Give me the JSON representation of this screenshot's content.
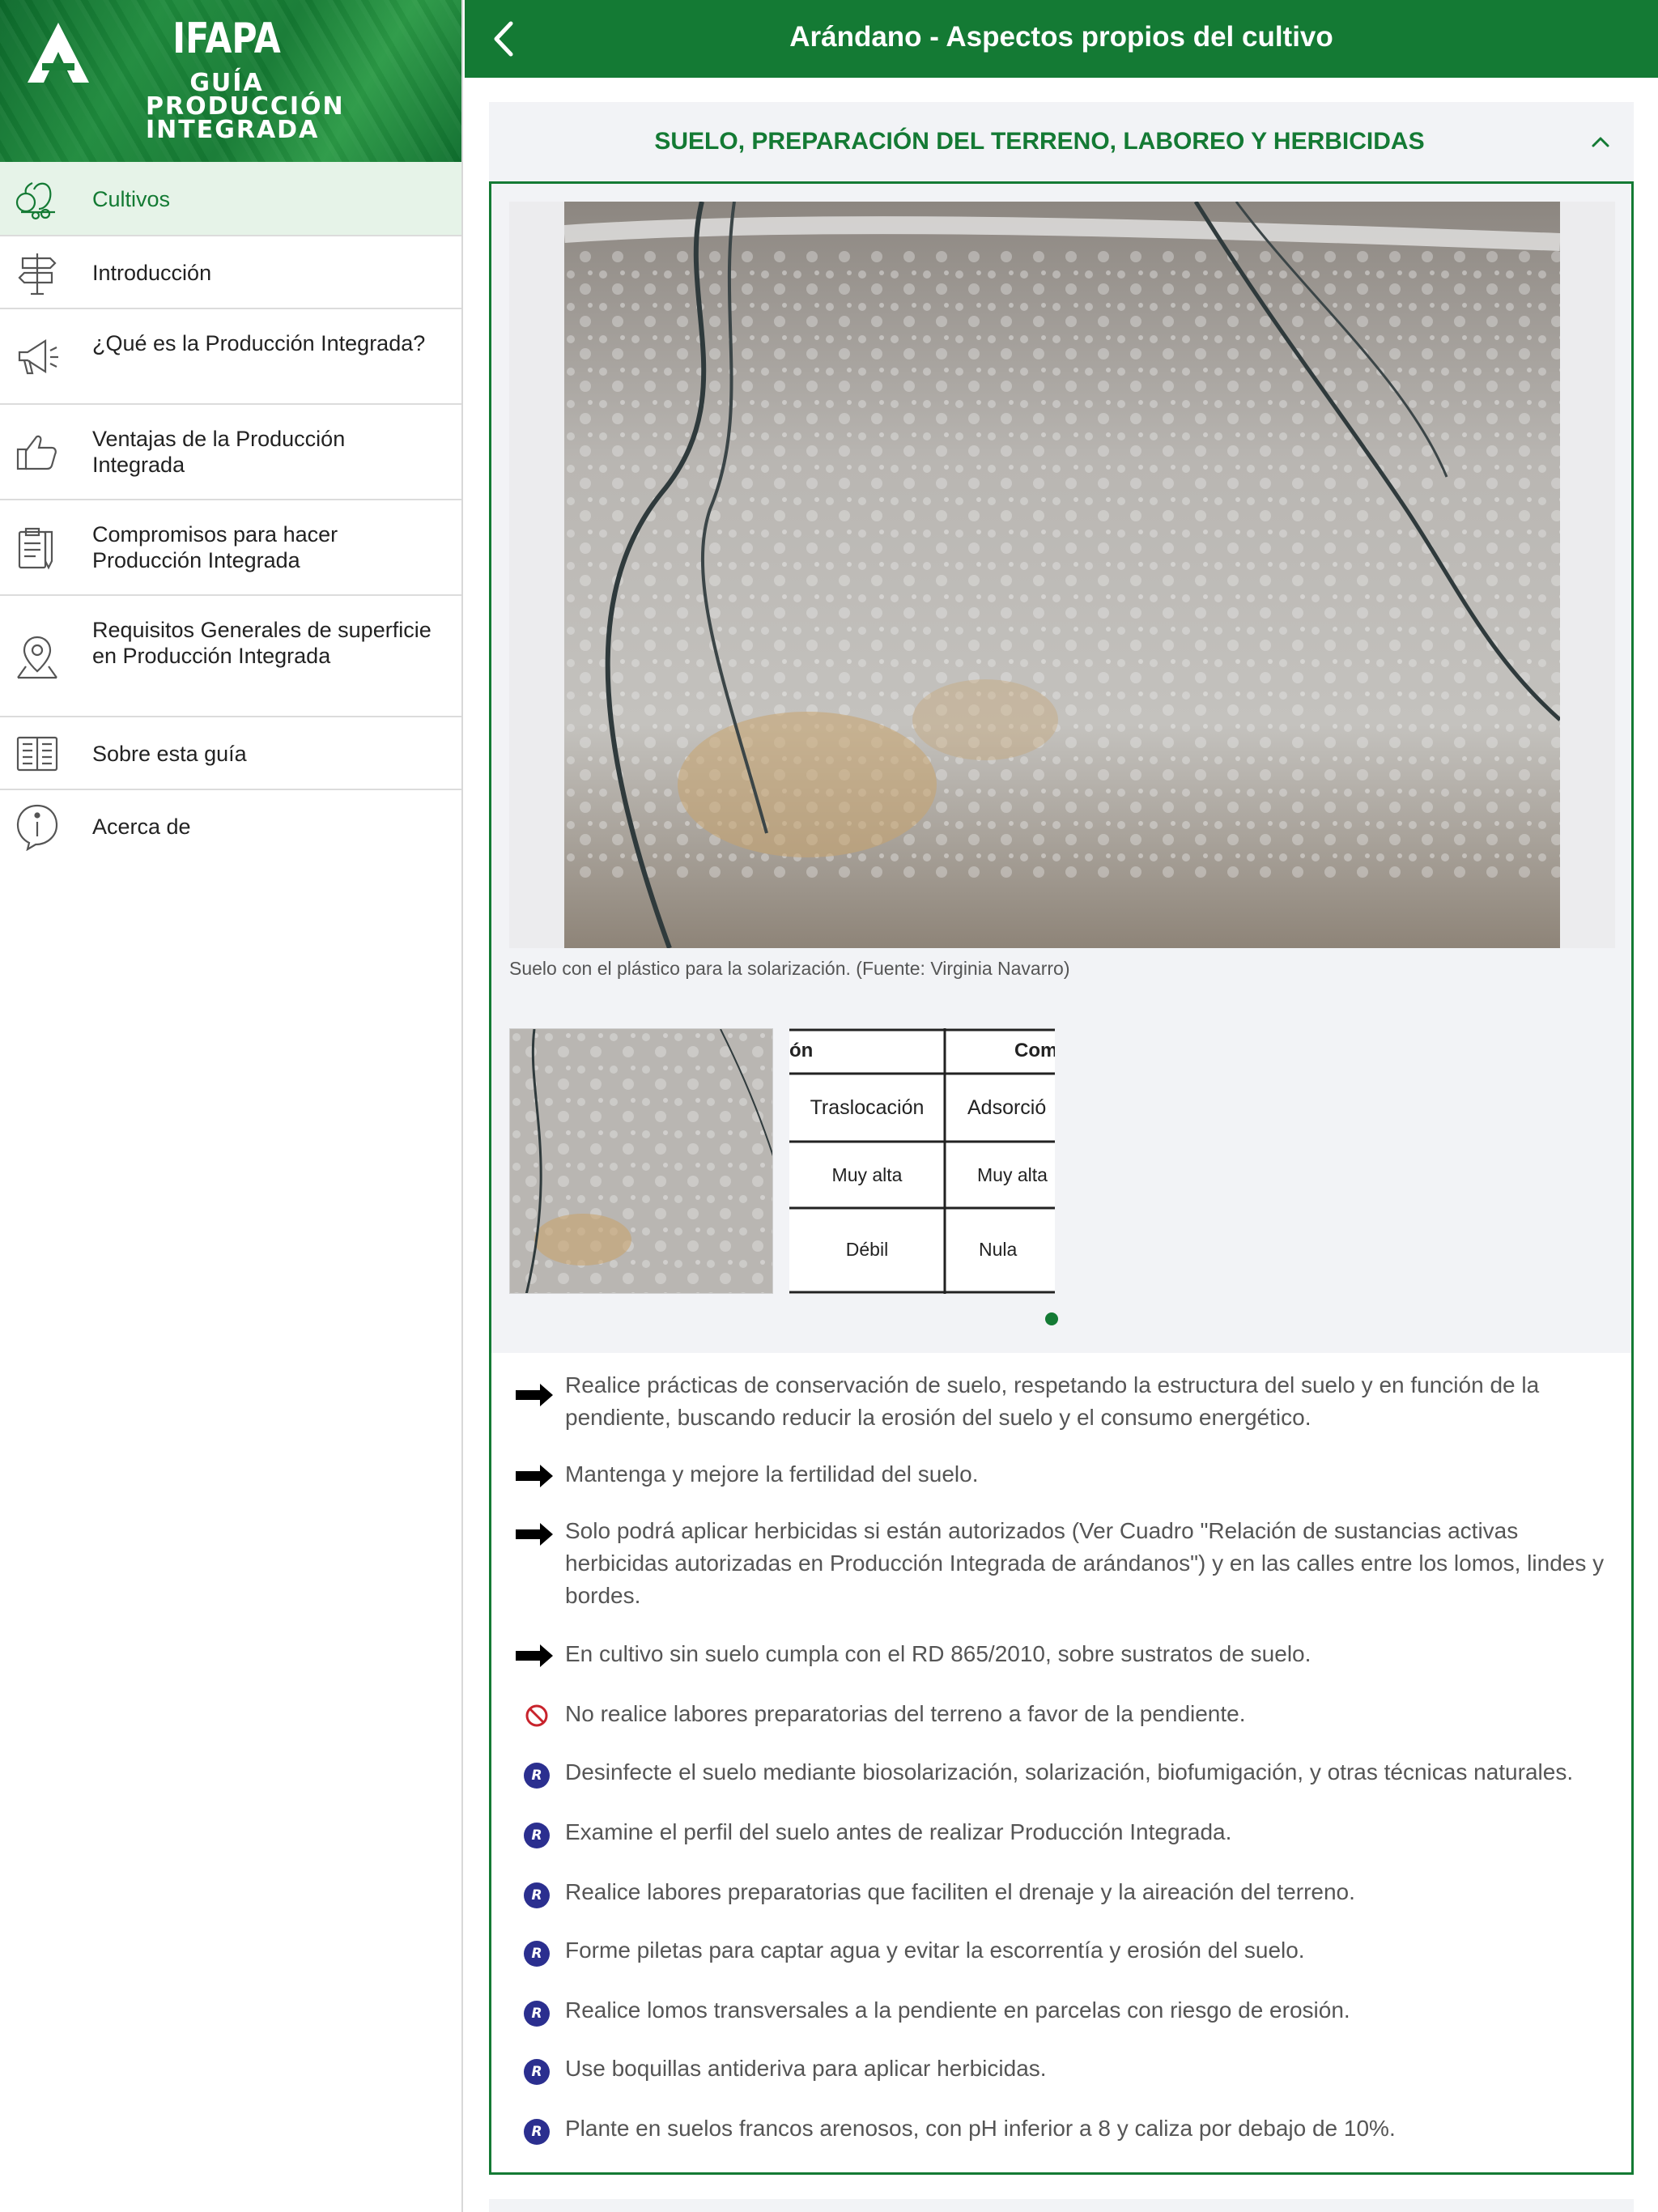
{
  "brand": {
    "name": "IFAPA",
    "subtitle_line1": "GUÍA",
    "subtitle_line2": "PRODUCCIÓN",
    "subtitle_line3": "INTEGRADA"
  },
  "sidebar": {
    "items": [
      {
        "label": "Cultivos",
        "icon": "crops-icon",
        "active": true
      },
      {
        "label": "Introducción",
        "icon": "signpost-icon"
      },
      {
        "label": "¿Qué es la Producción Integrada?",
        "icon": "megaphone-icon"
      },
      {
        "label": "Ventajas de la Producción Integrada",
        "icon": "thumbs-up-icon"
      },
      {
        "label": "Compromisos para hacer Producción Integrada",
        "icon": "clipboard-icon"
      },
      {
        "label": "Requisitos Generales de superficie en Producción Integrada",
        "icon": "map-pin-icon"
      },
      {
        "label": "Sobre esta guía",
        "icon": "book-icon"
      },
      {
        "label": "Acerca de",
        "icon": "info-icon"
      }
    ]
  },
  "header": {
    "title": "Arándano - Aspectos propios del cultivo"
  },
  "section": {
    "title": "SUELO, PREPARACIÓN DEL TERRENO, LABOREO Y HERBICIDAS",
    "caption": "Suelo con el plástico para la solarización. (Fuente: Virginia Navarro)",
    "table_thumb": {
      "h1": "ón",
      "h2": "Com",
      "r1c1": "Traslocación",
      "r1c2": "Adsorció",
      "r2c1": "Muy alta",
      "r2c2": "Muy alta",
      "r3c1": "Débil",
      "r3c2": "Nula"
    },
    "items": [
      {
        "type": "arrow",
        "text": "Realice prácticas de conservación de suelo, respetando la estructura del suelo y en función de la pendiente, buscando reducir la erosión del suelo y el consumo energético."
      },
      {
        "type": "arrow",
        "text": "Mantenga y mejore la fertilidad del suelo."
      },
      {
        "type": "arrow",
        "text": "Solo podrá aplicar herbicidas si están autorizados (Ver Cuadro \"Relación de sustancias activas herbicidas autorizadas en Producción Integrada de arándanos\") y en las calles entre los lomos, lindes y bordes."
      },
      {
        "type": "arrow",
        "text": "En cultivo sin suelo cumpla con el RD 865/2010, sobre sustratos de suelo."
      },
      {
        "type": "prohibited",
        "text": "No realice labores preparatorias del terreno a favor de la pendiente."
      },
      {
        "type": "recommended",
        "badge": "R",
        "text": "Desinfecte el suelo mediante biosolarización, solarización, biofumigación, y otras técnicas naturales."
      },
      {
        "type": "recommended",
        "badge": "R",
        "text": "Examine el perfil del suelo antes de realizar Producción Integrada."
      },
      {
        "type": "recommended",
        "badge": "R",
        "text": "Realice labores preparatorias que faciliten el drenaje y la aireación del terreno."
      },
      {
        "type": "recommended",
        "badge": "R",
        "text": "Forme piletas para captar agua y evitar la escorrentía y erosión del suelo."
      },
      {
        "type": "recommended",
        "badge": "R",
        "text": "Realice lomos transversales a la pendiente en parcelas con riesgo de erosión."
      },
      {
        "type": "recommended",
        "badge": "R",
        "text": "Use boquillas antideriva para aplicar herbicidas."
      },
      {
        "type": "recommended",
        "badge": "R",
        "text": "Plante en suelos francos arenosos, con pH inferior a 8 y caliza por debajo de 10%."
      }
    ]
  },
  "colors": {
    "primary_green": "#147a34",
    "active_bg": "#e6f3e8",
    "recommended_badge": "#2b2f8f",
    "prohibited_red": "#c8232c"
  }
}
